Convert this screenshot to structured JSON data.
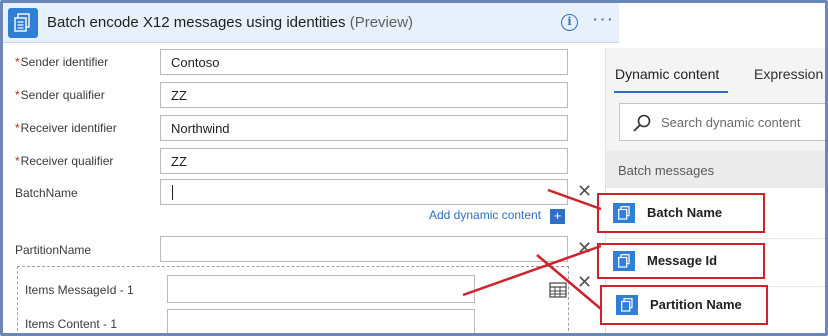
{
  "card": {
    "title": "Batch encode X12 messages using identities",
    "title_suffix": "(Preview)",
    "info_icon": "info-icon",
    "more_icon": "ellipsis-icon",
    "fields": [
      {
        "label": "Sender identifier",
        "required": true,
        "value": "Contoso"
      },
      {
        "label": "Sender qualifier",
        "required": true,
        "value": "ZZ"
      },
      {
        "label": "Receiver identifier",
        "required": true,
        "value": "Northwind"
      },
      {
        "label": "Receiver qualifier",
        "required": true,
        "value": "ZZ"
      },
      {
        "label": "BatchName",
        "required": false,
        "value": ""
      },
      {
        "label": "PartitionName",
        "required": false,
        "value": ""
      }
    ],
    "required_marker": "*",
    "clear_glyph": "✕",
    "add_dynamic_label": "Add dynamic content",
    "add_dynamic_plus": "+",
    "items": [
      {
        "label": "Items MessageId - 1",
        "value": ""
      },
      {
        "label": "Items Content - 1",
        "value": ""
      }
    ]
  },
  "panel": {
    "tabs": [
      "Dynamic content",
      "Expression"
    ],
    "active_tab": "Dynamic content",
    "search_placeholder": "Search dynamic content",
    "section_title": "Batch messages",
    "tokens": [
      "Batch Name",
      "Message Id",
      "Partition Name"
    ]
  },
  "colors": {
    "accent": "#2f6fc4",
    "icon_blue": "#2f7fd6",
    "highlight_red": "#d0202a",
    "frame_border": "#6a87b8"
  }
}
